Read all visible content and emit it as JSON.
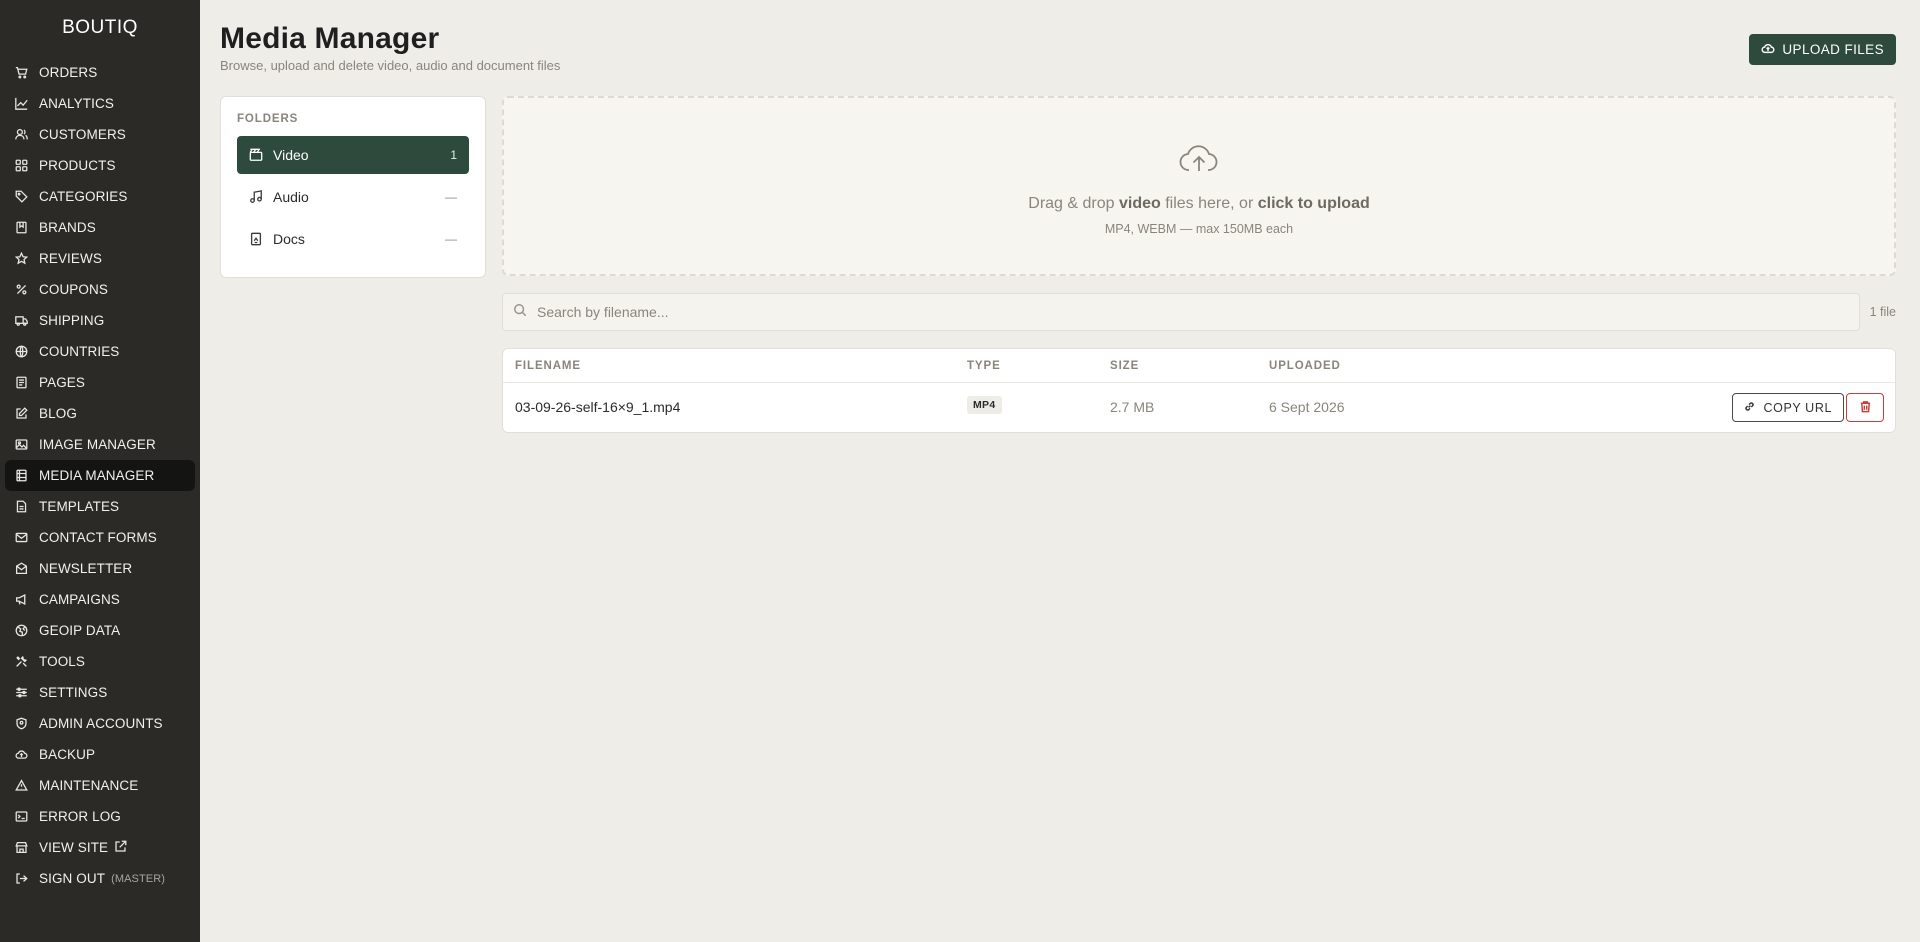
{
  "app": {
    "brand": "BOUTIQ"
  },
  "sidebar": {
    "items": [
      {
        "label": "ORDERS",
        "icon": "cart-icon"
      },
      {
        "label": "ANALYTICS",
        "icon": "chart-line-icon"
      },
      {
        "label": "CUSTOMERS",
        "icon": "users-icon"
      },
      {
        "label": "PRODUCTS",
        "icon": "grid-icon"
      },
      {
        "label": "CATEGORIES",
        "icon": "tag-icon"
      },
      {
        "label": "BRANDS",
        "icon": "bookmark-icon"
      },
      {
        "label": "REVIEWS",
        "icon": "star-icon"
      },
      {
        "label": "COUPONS",
        "icon": "percent-icon"
      },
      {
        "label": "SHIPPING",
        "icon": "truck-icon"
      },
      {
        "label": "COUNTRIES",
        "icon": "globe-icon"
      },
      {
        "label": "PAGES",
        "icon": "page-icon"
      },
      {
        "label": "BLOG",
        "icon": "edit-icon"
      },
      {
        "label": "IMAGE MANAGER",
        "icon": "image-icon"
      },
      {
        "label": "MEDIA MANAGER",
        "icon": "film-icon"
      },
      {
        "label": "TEMPLATES",
        "icon": "template-icon"
      },
      {
        "label": "CONTACT FORMS",
        "icon": "mail-icon"
      },
      {
        "label": "NEWSLETTER",
        "icon": "inbox-icon"
      },
      {
        "label": "CAMPAIGNS",
        "icon": "megaphone-icon"
      },
      {
        "label": "GEOIP DATA",
        "icon": "globe-pin-icon"
      },
      {
        "label": "TOOLS",
        "icon": "tools-icon"
      },
      {
        "label": "SETTINGS",
        "icon": "sliders-icon"
      },
      {
        "label": "ADMIN ACCOUNTS",
        "icon": "shield-icon"
      },
      {
        "label": "BACKUP",
        "icon": "cloud-backup-icon"
      },
      {
        "label": "MAINTENANCE",
        "icon": "triangle-icon"
      },
      {
        "label": "ERROR LOG",
        "icon": "terminal-icon"
      },
      {
        "label": "VIEW SITE",
        "icon": "store-icon",
        "suffix_icon": "external-link-icon"
      },
      {
        "label": "SIGN OUT",
        "icon": "sign-out-icon",
        "suffix": "(MASTER)"
      }
    ],
    "active": "MEDIA MANAGER"
  },
  "header": {
    "title": "Media Manager",
    "subtitle": "Browse, upload and delete video, audio and document files",
    "upload_label": "UPLOAD FILES"
  },
  "folders": {
    "title": "FOLDERS",
    "items": [
      {
        "label": "Video",
        "count": "1",
        "icon": "video-folder-icon",
        "active": true
      },
      {
        "label": "Audio",
        "count": "—",
        "icon": "music-note-icon",
        "active": false
      },
      {
        "label": "Docs",
        "count": "—",
        "icon": "document-icon",
        "active": false
      }
    ]
  },
  "dropzone": {
    "text_pre": "Drag & drop ",
    "text_bold": "video",
    "text_mid": " files here, or ",
    "text_link": "click to upload",
    "hint": "MP4, WEBM — max 150MB each"
  },
  "search": {
    "placeholder": "Search by filename...",
    "value": "",
    "count": "1 file"
  },
  "table": {
    "headers": [
      "FILENAME",
      "TYPE",
      "SIZE",
      "UPLOADED"
    ],
    "rows": [
      {
        "filename": "03-09-26-self-16×9_1.mp4",
        "type": "MP4",
        "size": "2.7 MB",
        "uploaded": "6 Sept 2026",
        "copy_label": "COPY URL"
      }
    ]
  },
  "colors": {
    "sidebar_bg": "#2b2a27",
    "accent": "#2d4a3d",
    "page_bg": "#efede8",
    "danger": "#c9403a"
  }
}
